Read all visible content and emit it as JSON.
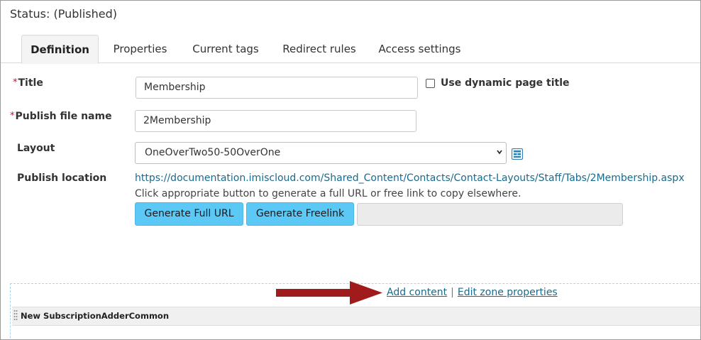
{
  "status": "Status: (Published)",
  "tabs": [
    {
      "label": "Definition",
      "active": true
    },
    {
      "label": "Properties",
      "active": false
    },
    {
      "label": "Current tags",
      "active": false
    },
    {
      "label": "Redirect rules",
      "active": false
    },
    {
      "label": "Access settings",
      "active": false
    }
  ],
  "form": {
    "required_marker": "*",
    "title_label": "Title",
    "title_value": "Membership",
    "dynamic_title_label": "Use dynamic page title",
    "dynamic_title_checked": false,
    "publish_file_label": "Publish file name",
    "publish_file_value": "2Membership",
    "layout_label": "Layout",
    "layout_value": "OneOverTwo50-50OverOne",
    "layout_icon": "layout-preview-icon",
    "publish_location_label": "Publish location",
    "publish_location_url": "https://documentation.imiscloud.com/Shared_Content/Contacts/Contact-Layouts/Staff/Tabs/2Membership.aspx",
    "hint": "Click appropriate button to generate a full URL or free link to copy elsewhere.",
    "generate_full_url": "Generate Full URL",
    "generate_freelink": "Generate Freelink",
    "generated_value": ""
  },
  "zone": {
    "add_content": "Add content",
    "separator": "|",
    "edit_zone_properties": "Edit zone properties",
    "content_title": "New SubscriptionAdderCommon"
  },
  "colors": {
    "required": "#c8102e",
    "link": "#1a6a8c",
    "button": "#5bc8f5",
    "arrow": "#a01c1c",
    "zone_border": "#a8d4ec"
  }
}
